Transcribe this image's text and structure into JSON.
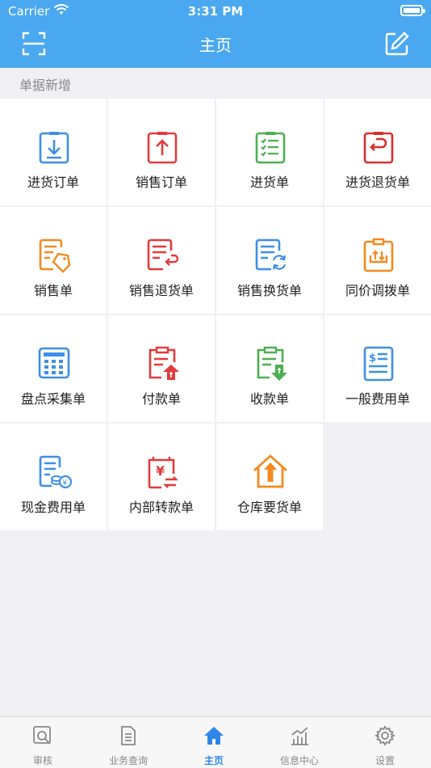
{
  "status_bar": {
    "carrier": "Carrier",
    "time": "3:31 PM"
  },
  "nav": {
    "title": "主页",
    "left_icon": "scan-icon",
    "right_icon": "edit-icon"
  },
  "section": {
    "title": "单据新增"
  },
  "grid_items": [
    {
      "label": "进货订单",
      "icon": "download-clipboard-icon",
      "color": "#3d8fe6"
    },
    {
      "label": "销售订单",
      "icon": "upload-clipboard-icon",
      "color": "#e23b3b"
    },
    {
      "label": "进货单",
      "icon": "checklist-clipboard-icon",
      "color": "#4caf50"
    },
    {
      "label": "进货退货单",
      "icon": "return-clipboard-icon",
      "color": "#d9302c"
    },
    {
      "label": "销售单",
      "icon": "price-tag-doc-icon",
      "color": "#f28a1e"
    },
    {
      "label": "销售退货单",
      "icon": "return-doc-icon",
      "color": "#e23b3b"
    },
    {
      "label": "销售换货单",
      "icon": "exchange-doc-icon",
      "color": "#3d8fe6"
    },
    {
      "label": "同价调拨单",
      "icon": "transfer-clipboard-icon",
      "color": "#f28a1e"
    },
    {
      "label": "盘点采集单",
      "icon": "calculator-icon",
      "color": "#3d8fe6"
    },
    {
      "label": "付款单",
      "icon": "payment-clipboard-icon",
      "color": "#e23b3b"
    },
    {
      "label": "收款单",
      "icon": "receipt-clipboard-icon",
      "color": "#4caf50"
    },
    {
      "label": "一般费用单",
      "icon": "expense-doc-icon",
      "color": "#3d8fe6"
    },
    {
      "label": "现金费用单",
      "icon": "cash-coins-icon",
      "color": "#3d8fe6"
    },
    {
      "label": "内部转款单",
      "icon": "internal-transfer-icon",
      "color": "#e23b3b"
    },
    {
      "label": "仓库要货单",
      "icon": "warehouse-up-icon",
      "color": "#f28a1e"
    }
  ],
  "tabs": [
    {
      "label": "审核",
      "icon": "audit-icon",
      "active": false
    },
    {
      "label": "业务查询",
      "icon": "document-icon",
      "active": false
    },
    {
      "label": "主页",
      "icon": "home-icon",
      "active": true
    },
    {
      "label": "信息中心",
      "icon": "chart-icon",
      "active": false
    },
    {
      "label": "设置",
      "icon": "gear-icon",
      "active": false
    }
  ],
  "colors": {
    "nav_bg": "#4aa8f0",
    "tab_active": "#2f86e8",
    "tab_inactive": "#888888"
  }
}
